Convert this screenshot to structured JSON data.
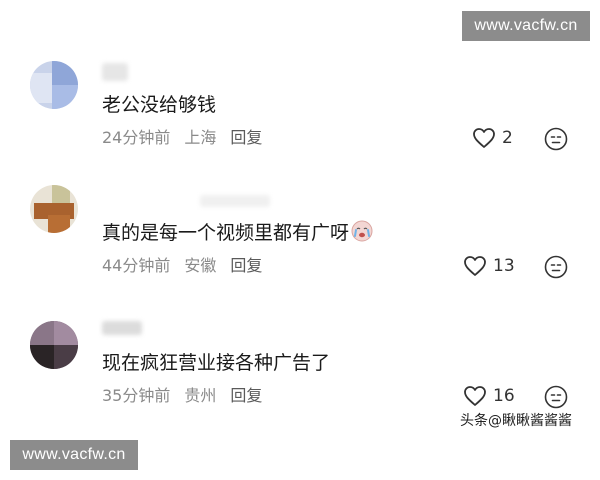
{
  "watermarks": {
    "top": "www.vacfw.cn",
    "bottom": "www.vacfw.cn"
  },
  "source": "头条@瞅瞅酱酱酱",
  "icons": {
    "like": "heart-outline-icon",
    "dislike": "neutral-face-icon",
    "emoji": "crying-face-emoji"
  },
  "comments": [
    {
      "text": "老公没给够钱",
      "time": "24分钟前",
      "location": "上海",
      "reply": "回复",
      "likes": "2"
    },
    {
      "text": "真的是每一个视频里都有广呀",
      "time": "44分钟前",
      "location": "安徽",
      "reply": "回复",
      "likes": "13"
    },
    {
      "text": "现在疯狂营业接各种广告了",
      "time": "35分钟前",
      "location": "贵州",
      "reply": "回复",
      "likes": "16"
    }
  ]
}
